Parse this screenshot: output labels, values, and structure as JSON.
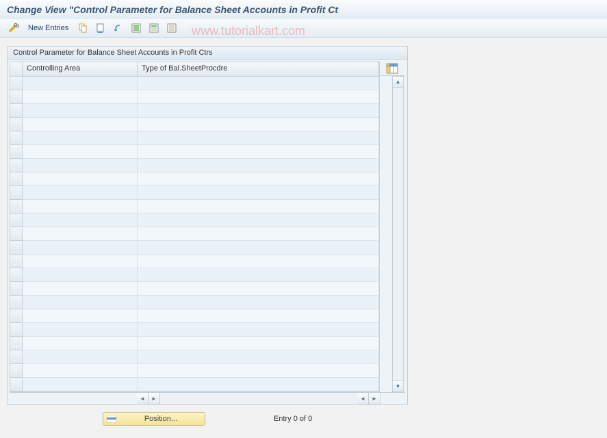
{
  "title": "Change View \"Control Parameter for Balance Sheet Accounts in Profit Ct",
  "watermark": "www.tutorialkart.com",
  "toolbar": {
    "new_entries_label": "New Entries"
  },
  "panel": {
    "title": "Control Parameter for Balance Sheet Accounts in Profit Ctrs",
    "columns": {
      "col1": "Controlling Area",
      "col2": "Type of Bal.SheetProcdre"
    },
    "rows": 23
  },
  "footer": {
    "position_label": "Position...",
    "entry_status": "Entry 0 of 0"
  }
}
